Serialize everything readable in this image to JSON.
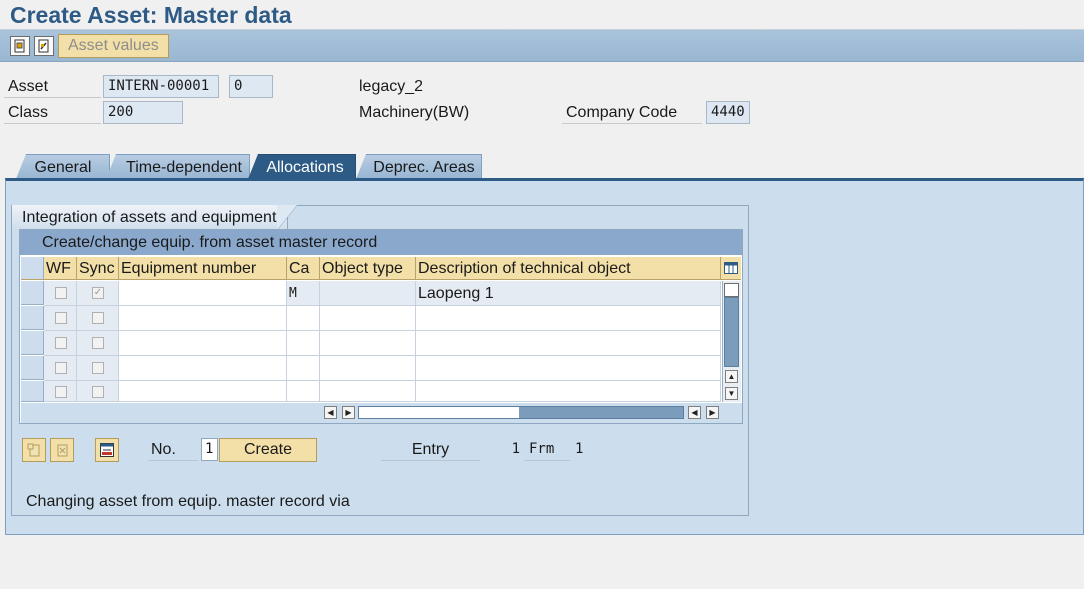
{
  "window": {
    "title": "Create Asset:  Master data"
  },
  "toolbar": {
    "asset_values_label": "Asset values",
    "icon1": "document-overview-icon",
    "icon2": "document-change-icon"
  },
  "header": {
    "asset_label": "Asset",
    "asset_number": "INTERN-00001",
    "sub_number": "0",
    "asset_description": "legacy_2",
    "class_label": "Class",
    "class_value": "200",
    "class_description": "Machinery(BW)",
    "company_code_label": "Company Code",
    "company_code_value": "4440"
  },
  "tabs": [
    {
      "label": "General",
      "active": false
    },
    {
      "label": "Time-dependent",
      "active": false
    },
    {
      "label": "Allocations",
      "active": true
    },
    {
      "label": "Deprec. Areas",
      "active": false
    }
  ],
  "group": {
    "title": "Integration of assets and equipment",
    "table_caption": "Create/change equip. from asset master record",
    "columns": [
      "WF",
      "Sync",
      "Equipment number",
      "Ca",
      "Object type",
      "Description of technical object"
    ],
    "rows": [
      {
        "wf": false,
        "sync": true,
        "equipment": "",
        "category": "M",
        "object_type": "",
        "description": "Laopeng 1"
      },
      {
        "wf": false,
        "sync": false,
        "equipment": "",
        "category": "",
        "object_type": "",
        "description": ""
      },
      {
        "wf": false,
        "sync": false,
        "equipment": "",
        "category": "",
        "object_type": "",
        "description": ""
      },
      {
        "wf": false,
        "sync": false,
        "equipment": "",
        "category": "",
        "object_type": "",
        "description": ""
      },
      {
        "wf": false,
        "sync": false,
        "equipment": "",
        "category": "",
        "object_type": "",
        "description": ""
      }
    ],
    "no_label": "No.",
    "no_value": "1",
    "create_label": "Create",
    "entry_label": "Entry",
    "entry_current": "1",
    "entry_from_label": "Frm",
    "entry_total": "1",
    "changing_text": "Changing asset from equip. master record via"
  },
  "colors": {
    "title": "#2e5b86",
    "active_tab": "#2e5b86",
    "button": "#f3e0a8",
    "panel": "#ccdeed",
    "table_caption": "#8aa8cc"
  }
}
